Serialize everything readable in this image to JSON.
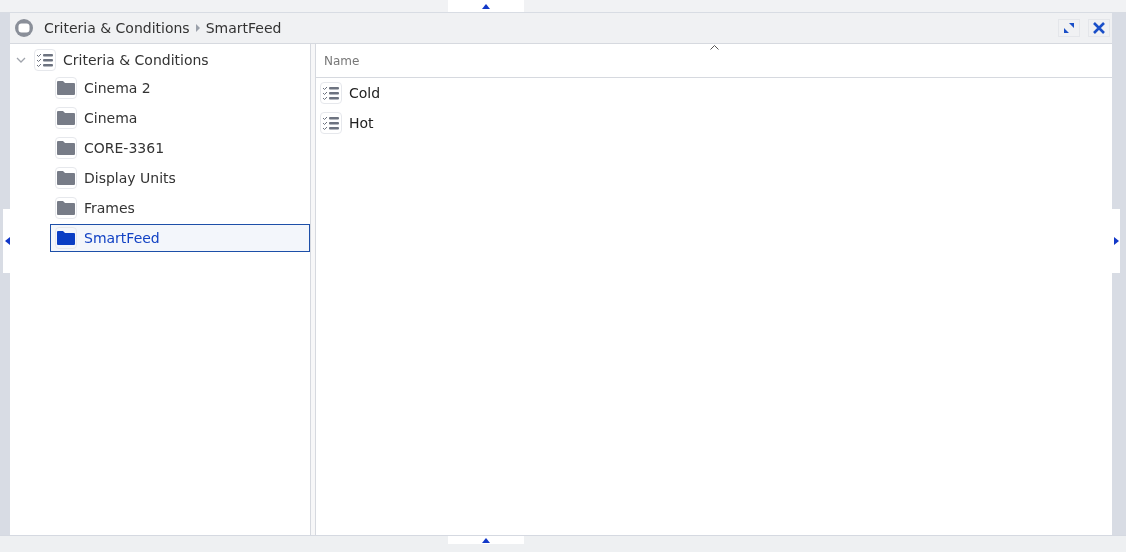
{
  "breadcrumb": [
    "Criteria & Conditions",
    "SmartFeed"
  ],
  "tree": {
    "label": "Criteria & Conditions",
    "expanded": true,
    "children": [
      {
        "label": "Cinema 2",
        "selected": false
      },
      {
        "label": "Cinema",
        "selected": false
      },
      {
        "label": "CORE-3361",
        "selected": false
      },
      {
        "label": "Display Units",
        "selected": false
      },
      {
        "label": "Frames",
        "selected": false
      },
      {
        "label": "SmartFeed",
        "selected": true
      }
    ]
  },
  "table": {
    "columns": [
      "Name"
    ],
    "rows": [
      {
        "name": "Cold"
      },
      {
        "name": "Hot"
      }
    ]
  }
}
